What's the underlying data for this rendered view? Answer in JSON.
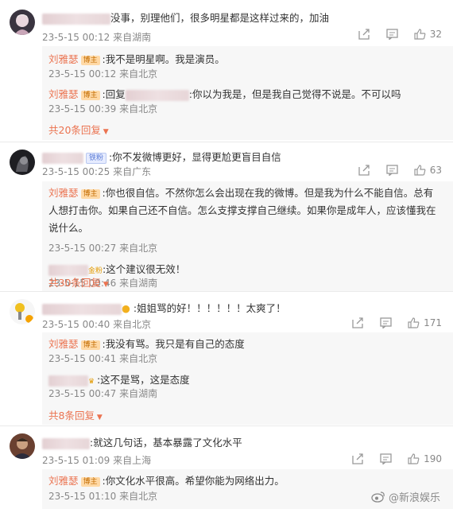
{
  "comments": [
    {
      "text": "没事，别理他们，很多明星都是这样过来的，加油",
      "time": "23-5-15 00:12",
      "loc": "来自湖南",
      "likes": "32",
      "replies": [
        {
          "name": "刘雅瑟",
          "badge": "博主",
          "text": ":我不是明星啊。我是演员。",
          "time": "23-5-15 00:12",
          "loc": "来自北京"
        },
        {
          "name": "刘雅瑟",
          "badge": "博主",
          "pre": ":回复",
          "text": ":你以为我是，但是我自己觉得不说是。不可以吗",
          "time": "23-5-15 00:39",
          "loc": "来自北京"
        }
      ],
      "more": "共20条回复"
    },
    {
      "badge": "铁粉",
      "text": ":你不发微博更好，显得更尬更盲目自信",
      "time": "23-5-15 00:25",
      "loc": "来自广东",
      "likes": "63",
      "replies": [
        {
          "name": "刘雅瑟",
          "badge": "博主",
          "text": ":你也很自信。不然你怎么会出现在我的微博。但是我为什么不能自信。总有人想打击你。如果自己还不自信。怎么支撑支撑自己继续。如果你是成年人，应该懂我在说什么。",
          "time": "23-5-15 00:27",
          "loc": "来自北京"
        },
        {
          "badge": "金粉",
          "text": ":这个建议很无效！",
          "time": "23-5-15 00:46",
          "loc": "来自湖南"
        }
      ],
      "more": "共30条回复"
    },
    {
      "text": ":姐姐骂的好！！！！！！太爽了！",
      "time": "23-5-15 00:40",
      "loc": "来自北京",
      "likes": "171",
      "replies": [
        {
          "name": "刘雅瑟",
          "badge": "博主",
          "text": ":我没有骂。我只是有自己的态度",
          "time": "23-5-15 00:41",
          "loc": "来自北京"
        },
        {
          "text": ":这不是骂，这是态度",
          "time": "23-5-15 00:47",
          "loc": "来自湖南"
        }
      ],
      "more": "共8条回复"
    },
    {
      "text": ":就这几句话，基本暴露了文化水平",
      "time": "23-5-15 01:09",
      "loc": "来自上海",
      "likes": "190",
      "replies": [
        {
          "name": "刘雅瑟",
          "badge": "博主",
          "text": ":你文化水平很高。希望你能为网络出力。",
          "time": "23-5-15 01:10",
          "loc": "来自北京"
        }
      ]
    }
  ],
  "watermark": "@新浪娱乐",
  "colors": {
    "accent": "#eb7350",
    "meta": "#888888",
    "reply_bg": "#f7f7f7"
  },
  "icons": [
    "share-icon",
    "comment-icon",
    "like-icon",
    "chevron-down-icon",
    "weibo-logo-icon"
  ]
}
